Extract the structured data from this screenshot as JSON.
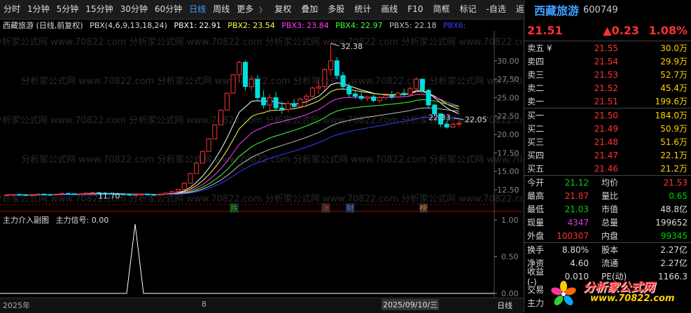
{
  "toolbar": {
    "items": [
      "分时",
      "1分钟",
      "5分钟",
      "15分钟",
      "30分钟",
      "60分钟",
      "日线",
      "周线",
      "更多"
    ],
    "active": "日线",
    "more_arrow": "〉",
    "tools": [
      "复权",
      "叠加",
      "多股",
      "统计",
      "画线",
      "F10",
      "简框",
      "标记",
      "-自选",
      "返回"
    ]
  },
  "legend": {
    "title": "西藏旅游 (日线,前复权)",
    "indicator": "PBX(4,6,9,13,18,24)",
    "pbx1": "PBX1: 22.91",
    "pbx2": "PBX2: 23.54",
    "pbx3": "PBX3: 23.84",
    "pbx4": "PBX4: 22.97",
    "pbx5": "PBX5: 22.18",
    "pbx6": "PBX6:"
  },
  "sub_legend": {
    "title": "主力介入副图",
    "signal": "主力信号: 0.00"
  },
  "chart_data": {
    "type": "candlestick",
    "y_axis_ticks": [
      "30.00",
      "27.50",
      "25.00",
      "22.50",
      "20.00",
      "17.50",
      "15.00",
      "12.50"
    ],
    "sub_y_axis_ticks": [
      "1.00",
      "0.50",
      "0.00"
    ],
    "price_annotations": {
      "high": "32.38",
      "low": "11.70",
      "pbx_label_1": "22.33",
      "pbx_label_2": "22.05"
    },
    "event_tags": [
      "跌",
      "涨",
      "财",
      "榜"
    ],
    "x_labels": [
      "2025年",
      "8",
      "2025/09/10/三"
    ],
    "bottom_right_label": "日线",
    "candles": [
      [
        11.8,
        11.9,
        11.7,
        11.8
      ],
      [
        11.8,
        11.9,
        11.7,
        11.85
      ],
      [
        11.85,
        11.95,
        11.75,
        11.8
      ],
      [
        11.8,
        11.9,
        11.7,
        11.75
      ],
      [
        11.75,
        11.85,
        11.7,
        11.8
      ],
      [
        11.8,
        11.95,
        11.75,
        11.9
      ],
      [
        11.9,
        12.0,
        11.8,
        11.85
      ],
      [
        11.85,
        11.95,
        11.75,
        11.8
      ],
      [
        11.8,
        11.95,
        11.75,
        11.9
      ],
      [
        11.9,
        12.05,
        11.85,
        12.0
      ],
      [
        12.0,
        12.1,
        11.9,
        11.95
      ],
      [
        11.95,
        12.05,
        11.85,
        11.9
      ],
      [
        11.9,
        12.0,
        11.8,
        11.95
      ],
      [
        11.95,
        12.1,
        11.9,
        12.05
      ],
      [
        12.05,
        12.2,
        12.0,
        12.1
      ],
      [
        12.1,
        12.2,
        12.0,
        12.05
      ],
      [
        12.05,
        12.15,
        11.95,
        12.0
      ],
      [
        12.0,
        12.1,
        11.9,
        11.95
      ],
      [
        11.95,
        12.05,
        11.85,
        11.9
      ],
      [
        11.9,
        12.0,
        11.8,
        11.85
      ],
      [
        11.85,
        11.95,
        11.75,
        11.8
      ],
      [
        11.8,
        11.9,
        11.7,
        11.8
      ],
      [
        11.8,
        11.95,
        11.75,
        11.9
      ],
      [
        11.9,
        12.0,
        11.8,
        11.85
      ],
      [
        11.85,
        11.95,
        11.75,
        11.8
      ],
      [
        11.8,
        11.95,
        11.75,
        11.9
      ],
      [
        11.9,
        12.1,
        11.85,
        12.05
      ],
      [
        12.05,
        12.3,
        12.0,
        12.25
      ],
      [
        12.25,
        12.6,
        12.2,
        12.55
      ],
      [
        12.55,
        13.5,
        12.5,
        13.4
      ],
      [
        13.4,
        14.8,
        13.4,
        14.7
      ],
      [
        14.7,
        16.2,
        14.7,
        16.1
      ],
      [
        16.1,
        17.8,
        16.1,
        17.7
      ],
      [
        17.7,
        19.5,
        17.7,
        19.4
      ],
      [
        19.4,
        21.4,
        19.4,
        21.3
      ],
      [
        21.3,
        23.4,
        21.3,
        23.3
      ],
      [
        23.3,
        25.7,
        23.3,
        25.6
      ],
      [
        25.6,
        28.2,
        25.6,
        28.1
      ],
      [
        28.1,
        30.0,
        27.0,
        29.8
      ],
      [
        29.8,
        30.0,
        26.0,
        26.5
      ],
      [
        26.5,
        28.0,
        26.0,
        27.5
      ],
      [
        27.5,
        28.0,
        24.5,
        25.0
      ],
      [
        25.0,
        26.0,
        23.5,
        24.0
      ],
      [
        24.0,
        25.5,
        23.0,
        25.0
      ],
      [
        25.0,
        25.8,
        23.3,
        23.6
      ],
      [
        23.6,
        24.5,
        22.8,
        23.4
      ],
      [
        23.4,
        24.5,
        23.0,
        24.2
      ],
      [
        24.2,
        24.8,
        23.5,
        23.8
      ],
      [
        23.8,
        25.0,
        23.5,
        24.8
      ],
      [
        24.8,
        25.5,
        24.0,
        25.2
      ],
      [
        25.2,
        26.5,
        25.0,
        26.3
      ],
      [
        26.3,
        27.5,
        25.5,
        26.5
      ],
      [
        26.5,
        29.0,
        26.0,
        28.8
      ],
      [
        28.8,
        32.38,
        28.0,
        30.0
      ],
      [
        30.0,
        30.5,
        27.5,
        28.0
      ],
      [
        28.0,
        28.5,
        26.0,
        26.5
      ],
      [
        26.5,
        27.0,
        25.0,
        25.5
      ],
      [
        25.5,
        26.0,
        24.8,
        25.2
      ],
      [
        25.2,
        25.8,
        24.6,
        24.9
      ],
      [
        24.9,
        25.3,
        24.5,
        25.1
      ],
      [
        25.1,
        25.4,
        24.4,
        24.6
      ],
      [
        24.6,
        25.2,
        24.3,
        25.0
      ],
      [
        25.0,
        25.6,
        24.7,
        25.3
      ],
      [
        25.3,
        25.9,
        24.8,
        25.1
      ],
      [
        25.1,
        25.8,
        24.9,
        25.6
      ],
      [
        25.6,
        26.2,
        25.1,
        25.4
      ],
      [
        25.4,
        26.5,
        25.2,
        26.2
      ],
      [
        26.2,
        27.8,
        25.8,
        27.5
      ],
      [
        27.5,
        27.6,
        25.8,
        26.0
      ],
      [
        26.0,
        26.2,
        23.6,
        24.0
      ],
      [
        24.0,
        24.2,
        22.5,
        22.8
      ],
      [
        22.8,
        22.9,
        21.0,
        21.4
      ],
      [
        21.4,
        21.8,
        20.8,
        21.0
      ],
      [
        21.0,
        21.6,
        20.9,
        21.4
      ],
      [
        21.4,
        21.9,
        21.0,
        21.51
      ]
    ]
  },
  "panel": {
    "name": "西藏旅游",
    "code": "600749",
    "price": "21.51",
    "change": "▲0.23",
    "change_pct": "1.08%",
    "asks": [
      {
        "label": "卖五 ¥",
        "price": "21.55",
        "vol": "30.0万"
      },
      {
        "label": "卖四",
        "price": "21.54",
        "vol": "29.9万"
      },
      {
        "label": "卖三",
        "price": "21.53",
        "vol": "52.7万"
      },
      {
        "label": "卖二",
        "price": "21.52",
        "vol": "45.4万"
      },
      {
        "label": "卖一",
        "price": "21.51",
        "vol": "199.6万"
      }
    ],
    "bids": [
      {
        "label": "买一",
        "price": "21.50",
        "vol": "184.0万"
      },
      {
        "label": "买二",
        "price": "21.49",
        "vol": "50.9万"
      },
      {
        "label": "买三",
        "price": "21.48",
        "vol": "51.6万"
      },
      {
        "label": "买四",
        "price": "21.47",
        "vol": "22.1万"
      },
      {
        "label": "买五",
        "price": "21.46",
        "vol": "21.2万"
      }
    ],
    "stats1": [
      {
        "l1": "今开",
        "v1": "21.12",
        "l2": "均价",
        "v2": "21.53"
      },
      {
        "l1": "最高",
        "v1": "21.87",
        "l2": "量比",
        "v2": "0.65"
      },
      {
        "l1": "最低",
        "v1": "21.03",
        "l2": "市值",
        "v2": "48.8亿"
      },
      {
        "l1": "现量",
        "v1": "4347",
        "l2": "总量",
        "v2": "199652"
      },
      {
        "l1": "外盘",
        "v1": "100307",
        "l2": "内盘",
        "v2": "99345"
      }
    ],
    "stats2": [
      {
        "l1": "换手",
        "v1": "8.80%",
        "l2": "股本",
        "v2": "2.27亿"
      },
      {
        "l1": "净资",
        "v1": "4.60",
        "l2": "流通",
        "v2": "2.27亿"
      },
      {
        "l1": "收益(-)",
        "v1": "0.010",
        "l2": "PE(动)",
        "v2": "1166.3"
      },
      {
        "l1": "交易",
        "v1": "",
        "l2": "",
        "v2": ""
      },
      {
        "l1": "主力",
        "v1": "",
        "l2": "",
        "v2": ""
      }
    ]
  },
  "watermark": {
    "text": "分析家公式网",
    "url": "www.70822.com"
  },
  "colors": {
    "up": "#ff3232",
    "down": "#00e0e0",
    "pbx1": "#ffffff",
    "pbx2": "#ffff50",
    "pbx3": "#ff40ff",
    "pbx4": "#40ff40",
    "pbx5": "#c0c0c0",
    "pbx6": "#3040ff"
  }
}
